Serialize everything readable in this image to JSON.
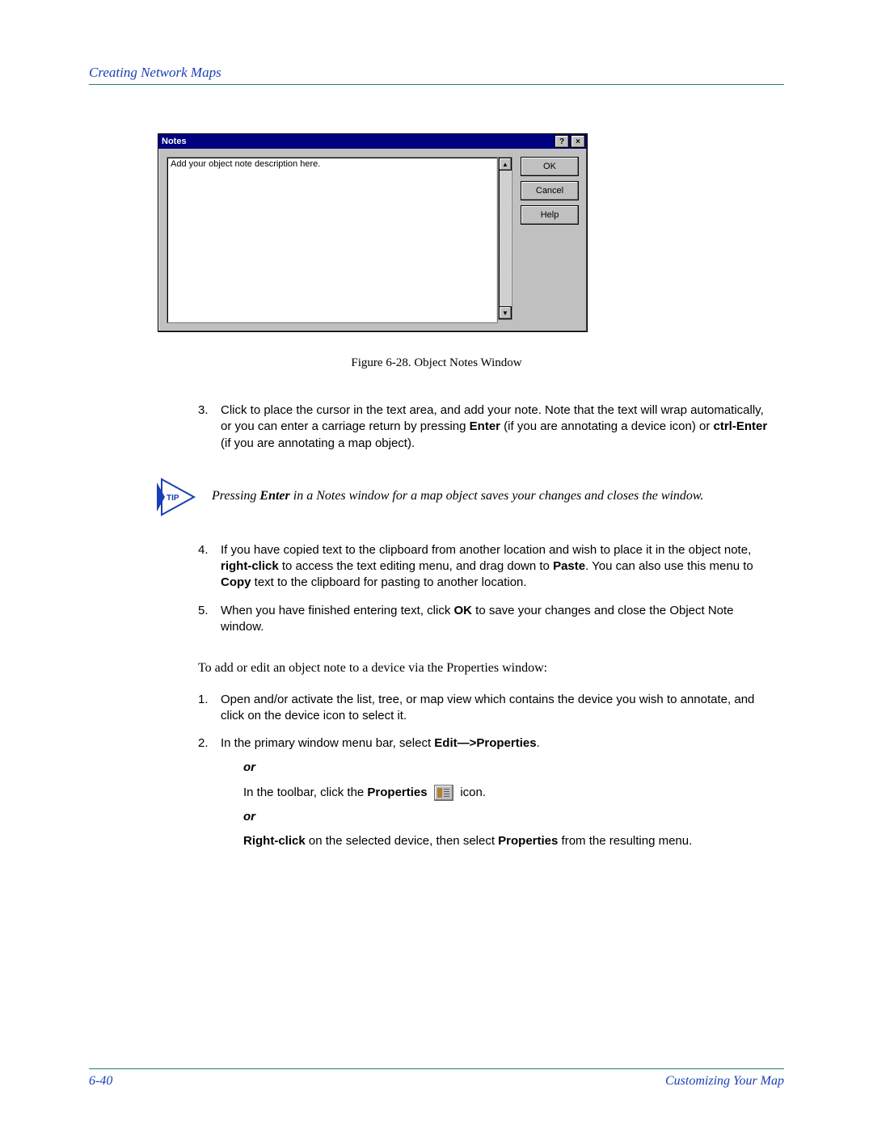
{
  "header": {
    "section_title": "Creating Network Maps"
  },
  "dialog": {
    "title": "Notes",
    "help_glyph": "?",
    "close_glyph": "×",
    "textarea_value": "Add your object note description here.",
    "scroll_up_glyph": "▲",
    "scroll_down_glyph": "▼",
    "buttons": {
      "ok": "OK",
      "cancel": "Cancel",
      "help": "Help"
    }
  },
  "caption": "Figure 6-28.  Object Notes Window",
  "steps_a": {
    "3": {
      "pre": "Click to place the cursor in the text area, and add your note. Note that the text will wrap automatically, or you can enter a carriage return by pressing ",
      "b1": "Enter",
      "mid": " (if you are annotating a device icon) or ",
      "b2": "ctrl-Enter",
      "post": " (if you are annotating a map object)."
    }
  },
  "tip": {
    "label": "TIP",
    "pre": "Pressing ",
    "b": "Enter",
    "post": " in a Notes window for a map object saves your changes and closes the window."
  },
  "steps_b": {
    "4": {
      "pre": "If you have copied text to the clipboard from another location and wish to place it in the object note, ",
      "b1": "right-click",
      "mid1": " to access the text editing menu, and drag down to ",
      "b2": "Paste",
      "mid2": ". You can also use this menu to ",
      "b3": "Copy",
      "post": " text to the clipboard for pasting to another location."
    },
    "5": {
      "pre": "When you have finished entering text, click ",
      "b1": "OK",
      "post": " to save your changes and close the Object Note window."
    }
  },
  "intro2": "To add or edit an object note to a device via the Properties window:",
  "steps_c": {
    "1": "Open and/or activate the list, tree, or map view which contains the device you wish to annotate, and click on the device icon to select it.",
    "2": {
      "pre": "In the primary window menu bar, select ",
      "b1": "Edit—>Properties",
      "post": "."
    },
    "or": "or",
    "alt1": {
      "pre": "In the toolbar, click the ",
      "b": "Properties",
      "post": " icon."
    },
    "alt2": {
      "b1": "Right-click",
      "mid": " on the selected device, then select ",
      "b2": "Properties",
      "post": " from the resulting menu."
    }
  },
  "footer": {
    "page": "6-40",
    "title": "Customizing Your Map"
  }
}
